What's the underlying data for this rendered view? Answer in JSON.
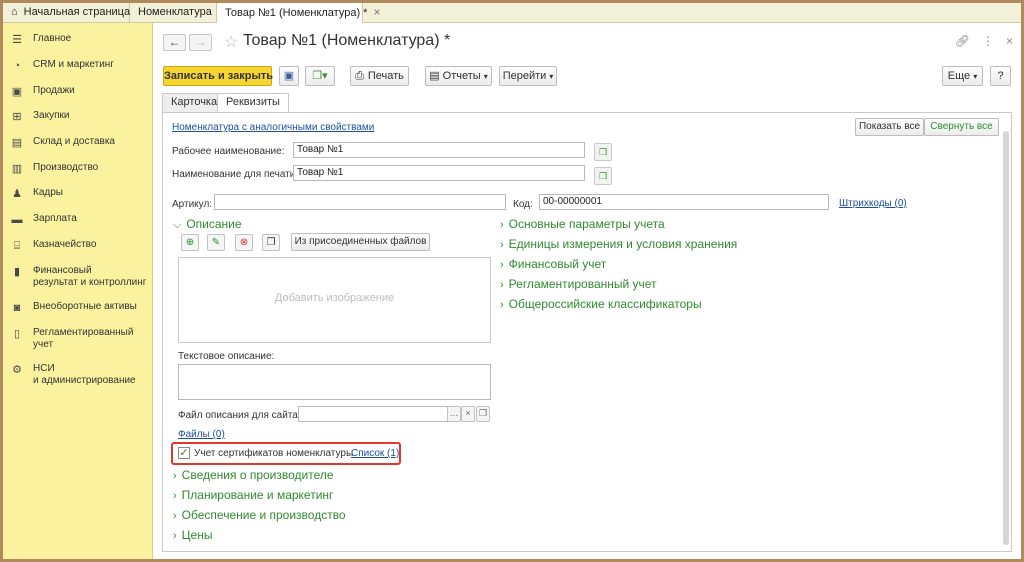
{
  "open_tabs": [
    {
      "label": "Начальная страница"
    },
    {
      "label": "Номенклатура"
    },
    {
      "label": "Товар №1 (Номенклатура) *"
    }
  ],
  "sidebar": {
    "items": [
      {
        "label": "Главное",
        "icon": "menu-icon"
      },
      {
        "label": "CRM и маркетинг",
        "icon": "pie-chart-icon"
      },
      {
        "label": "Продажи",
        "icon": "bag-icon"
      },
      {
        "label": "Закупки",
        "icon": "cart-icon"
      },
      {
        "label": "Склад и доставка",
        "icon": "truck-icon"
      },
      {
        "label": "Производство",
        "icon": "factory-icon"
      },
      {
        "label": "Кадры",
        "icon": "person-icon"
      },
      {
        "label": "Зарплата",
        "icon": "wallet-icon"
      },
      {
        "label": "Казначейство",
        "icon": "bank-icon"
      },
      {
        "label": "Финансовый\nрезультат и контроллинг",
        "icon": "bar-chart-icon"
      },
      {
        "label": "Внеоборотные активы",
        "icon": "assets-icon"
      },
      {
        "label": "Регламентированный\nучет",
        "icon": "document-icon"
      },
      {
        "label": "НСИ\nи администрирование",
        "icon": "gear-icon"
      }
    ]
  },
  "header": {
    "title": "Товар №1 (Номенклатура) *"
  },
  "toolbar": {
    "save_close": "Записать и закрыть",
    "print": "Печать",
    "reports": "Отчеты",
    "goto": "Перейти",
    "more": "Еще",
    "help": "?"
  },
  "tabs": [
    {
      "label": "Карточка"
    },
    {
      "label": "Реквизиты"
    }
  ],
  "form": {
    "similar_link": "Номенклатура с аналогичными свойствами",
    "show_all": "Показать все",
    "collapse_all": "Свернуть все",
    "work_name_label": "Рабочее наименование:",
    "work_name_value": "Товар №1",
    "print_name_label": "Наименование для печати:",
    "print_name_value": "Товар №1",
    "article_label": "Артикул:",
    "article_value": "",
    "code_label": "Код:",
    "code_value": "00-00000001",
    "barcodes_link": "Штрихкоды (0)",
    "description_group": "Описание",
    "from_files_btn": "Из присоединенных файлов",
    "add_image": "Добавить изображение",
    "text_desc_label": "Текстовое описание:",
    "site_file_label": "Файл описания для сайта:",
    "files_link": "Файлы (0)",
    "cert_checkbox_label": "Учет сертификатов номенклатуры",
    "cert_checked": true,
    "cert_list_link": "Список (1)",
    "left_groups": [
      {
        "label": "Сведения о производителе"
      },
      {
        "label": "Планирование и маркетинг"
      },
      {
        "label": "Обеспечение и производство"
      },
      {
        "label": "Цены"
      }
    ],
    "right_groups": [
      {
        "label": "Основные параметры учета"
      },
      {
        "label": "Единицы измерения и условия хранения"
      },
      {
        "label": "Финансовый учет"
      },
      {
        "label": "Регламентированный учет"
      },
      {
        "label": "Общероссийские классификаторы"
      }
    ]
  },
  "colors": {
    "accent_yellow": "#f6d52f",
    "sidebar_bg": "#fbf2a0",
    "group_green": "#2f8a2f",
    "highlight_red": "#e0382b"
  }
}
